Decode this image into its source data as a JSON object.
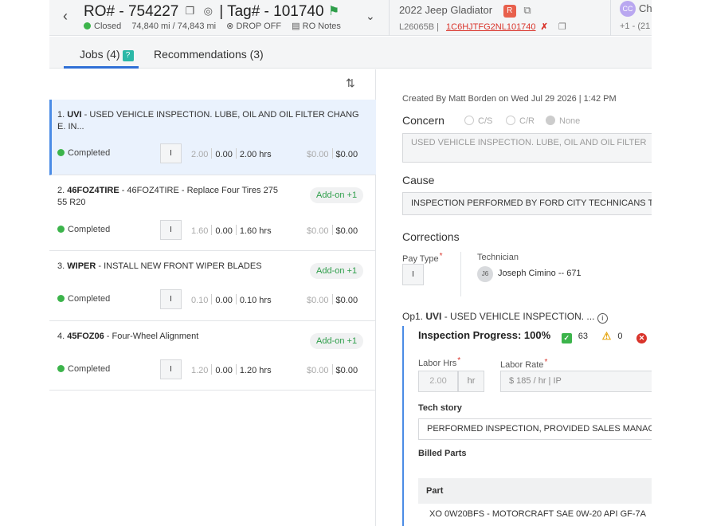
{
  "header": {
    "ro_label": "RO# - 754227",
    "tag_label": "| Tag# - 101740",
    "status": "Closed",
    "mileage": "74,840 mi / 74,843 mi",
    "drop_off": "DROP OFF",
    "ro_notes": "RO Notes",
    "vehicle_name": "2022 Jeep Gladiator",
    "vehicle_badge": "R",
    "stock": "L26065B |",
    "vin": "1C6HJTFG2NL101740",
    "customer_initials": "CC",
    "customer_name": "Ch",
    "customer_phone": "+1 - (21"
  },
  "tabs": [
    {
      "label": "Jobs (4)"
    },
    {
      "label": "Recommendations (3)"
    }
  ],
  "jobs": [
    {
      "num": "1.",
      "code": "UVI",
      "desc": " - USED VEHICLE INSPECTION. LUBE, OIL AND OIL FILTER CHANG E. IN...",
      "addon": "",
      "status": "Completed",
      "pay": "I",
      "hrs_a": "2.00",
      "hrs_b": "0.00",
      "hrs_c": "2.00 hrs",
      "amt_a": "$0.00",
      "amt_b": "$0.00"
    },
    {
      "num": "2.",
      "code": "46FOZ4TIRE",
      "desc": " - 46FOZ4TIRE - Replace Four Tires 275 55 R20",
      "addon": "Add-on +1",
      "status": "Completed",
      "pay": "I",
      "hrs_a": "1.60",
      "hrs_b": "0.00",
      "hrs_c": "1.60 hrs",
      "amt_a": "$0.00",
      "amt_b": "$0.00"
    },
    {
      "num": "3.",
      "code": "WIPER",
      "desc": " - INSTALL NEW FRONT WIPER BLADES",
      "addon": "Add-on +1",
      "status": "Completed",
      "pay": "I",
      "hrs_a": "0.10",
      "hrs_b": "0.00",
      "hrs_c": "0.10 hrs",
      "amt_a": "$0.00",
      "amt_b": "$0.00"
    },
    {
      "num": "4.",
      "code": "45FOZ06",
      "desc": " - Four-Wheel Alignment",
      "addon": "Add-on +1",
      "status": "Completed",
      "pay": "I",
      "hrs_a": "1.20",
      "hrs_b": "0.00",
      "hrs_c": "1.20 hrs",
      "amt_a": "$0.00",
      "amt_b": "$0.00"
    }
  ],
  "detail": {
    "created": "Created By Matt Borden on Wed Jul 29 2026 | 1:42 PM",
    "concern_label": "Concern",
    "radio_cs": "C/S",
    "radio_cr": "C/R",
    "radio_none": "None",
    "concern_text": "USED VEHICLE INSPECTION. LUBE, OIL AND OIL FILTER",
    "cause_label": "Cause",
    "cause_text": "INSPECTION PERFORMED BY FORD CITY TECHNICANS TO",
    "corrections_label": "Corrections",
    "pay_type_label": "Pay Type",
    "pay_type_value": "I",
    "technician_label": "Technician",
    "tech_initials": "J6",
    "tech_name": "Joseph Cimino -- 671",
    "op_prefix": "Op1.",
    "op_code": "UVI",
    "op_desc": " - USED VEHICLE INSPECTION. ...",
    "progress_label": "Inspection Progress: 100%",
    "pass_count": "63",
    "warn_count": "0",
    "labor_hrs_label": "Labor Hrs",
    "labor_hrs_value": "2.00",
    "hr_unit": "hr",
    "labor_rate_label": "Labor Rate",
    "labor_rate_value": "$ 185 / hr | IP",
    "tech_story_label": "Tech story",
    "tech_story_text": "PERFORMED INSPECTION, PROVIDED SALES MANAG",
    "billed_parts_label": "Billed Parts",
    "part_col": "Part",
    "part_row": "XO 0W20BFS - MOTORCRAFT SAE 0W-20 API GF-7A"
  },
  "colors": {
    "accent": "#2f6fd6",
    "status_green": "#3cb44b",
    "vin_red": "#d9342b",
    "addon_green": "#2e9e4a"
  }
}
